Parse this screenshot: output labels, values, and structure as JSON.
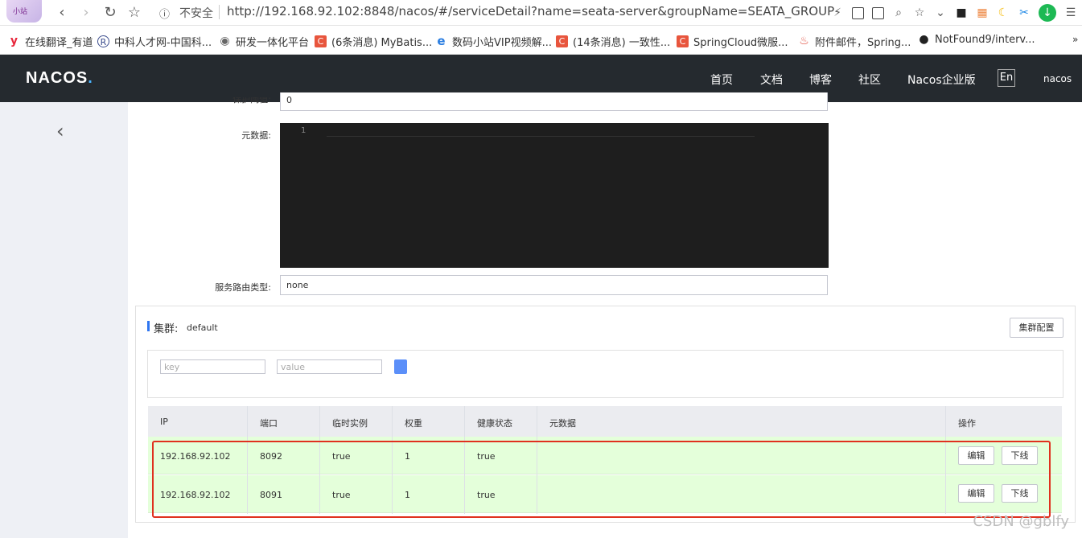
{
  "browser": {
    "address_info": "ⓘ",
    "insecure_label": "不安全",
    "url": "http://192.168.92.102:8848/nacos/#/serviceDetail?name=seata-server&groupName=SEATA_GROUP",
    "favicon_text": "小站"
  },
  "bookmarks": [
    {
      "label": "在线翻译_有道",
      "icon": "y",
      "color": "#e8273c"
    },
    {
      "label": "中科人才网-中国科...",
      "icon": "R",
      "color": "#3a4b8c"
    },
    {
      "label": "研发一体化平台",
      "icon": "◉",
      "color": "#666666"
    },
    {
      "label": "(6条消息) MyBatis...",
      "icon": "C",
      "color": "#e8553d"
    },
    {
      "label": "数码小站VIP视频解...",
      "icon": "e",
      "color": "#2a7de1"
    },
    {
      "label": "(14条消息) 一致性...",
      "icon": "C",
      "color": "#e8553d"
    },
    {
      "label": "SpringCloud微服...",
      "icon": "C",
      "color": "#e8553d"
    },
    {
      "label": "附件邮件，Spring...",
      "icon": "♨",
      "color": "#e04a3a"
    },
    {
      "label": "NotFound9/interv...",
      "icon": "●",
      "color": "#222222"
    }
  ],
  "header": {
    "logo": "NACOS",
    "logo_dot": ".",
    "nav": [
      "首页",
      "文档",
      "博客",
      "社区",
      "Nacos企业版"
    ],
    "lang": "En",
    "user": "nacos"
  },
  "form": {
    "threshold_label": "保护阈值:",
    "threshold_value": "0",
    "metadata_label": "元数据:",
    "editor_line": "1",
    "route_label": "服务路由类型:",
    "route_value": "none"
  },
  "cluster": {
    "title": "集群:",
    "name": "default",
    "config_button": "集群配置",
    "key_placeholder": "key",
    "value_placeholder": "value"
  },
  "table": {
    "headers": [
      "IP",
      "端口",
      "临时实例",
      "权重",
      "健康状态",
      "元数据",
      "操作"
    ],
    "rows": [
      {
        "ip": "192.168.92.102",
        "port": "8092",
        "ephemeral": "true",
        "weight": "1",
        "healthy": "true",
        "metadata": ""
      },
      {
        "ip": "192.168.92.102",
        "port": "8091",
        "ephemeral": "true",
        "weight": "1",
        "healthy": "true",
        "metadata": ""
      }
    ],
    "edit_label": "编辑",
    "offline_label": "下线"
  },
  "watermark": "CSDN @gblfy"
}
